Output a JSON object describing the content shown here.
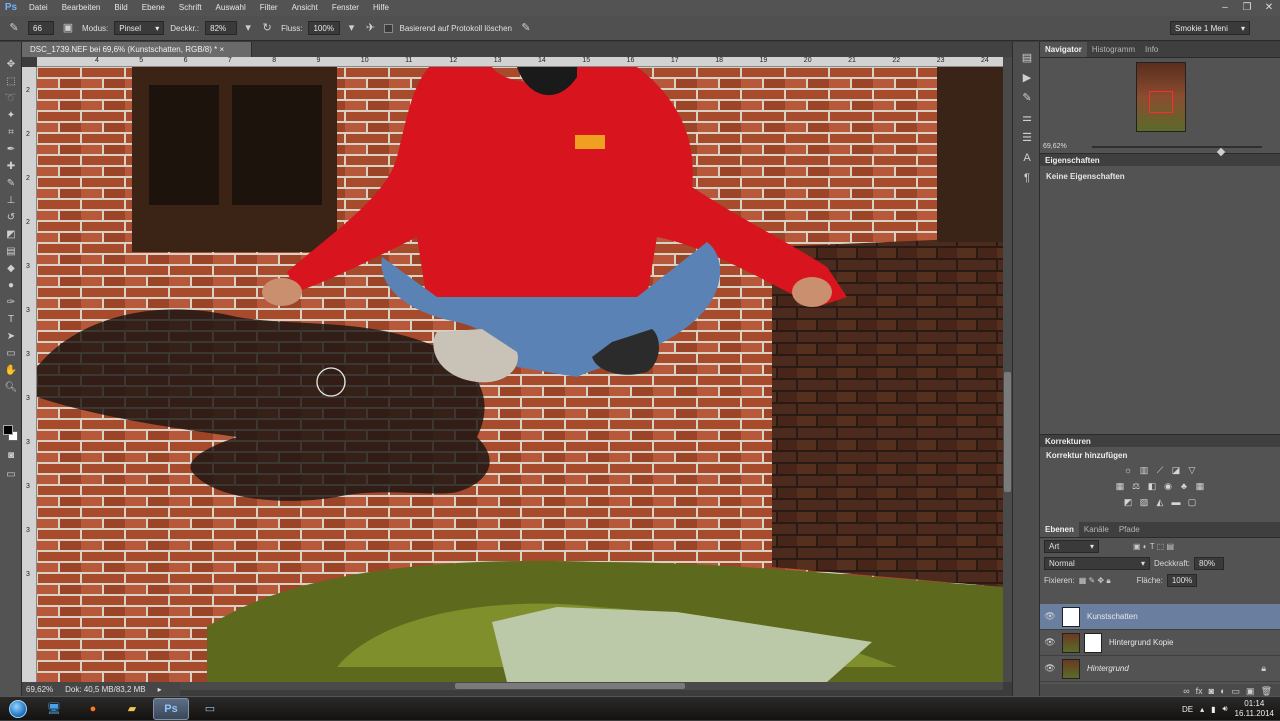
{
  "app": {
    "logo": "Ps"
  },
  "menu": [
    "Datei",
    "Bearbeiten",
    "Bild",
    "Ebene",
    "Schrift",
    "Auswahl",
    "Filter",
    "Ansicht",
    "Fenster",
    "Hilfe"
  ],
  "options": {
    "brush_size": "66",
    "modus_label": "Modus:",
    "modus_value": "Pinsel",
    "deckkr_label": "Deckkr.:",
    "deckkr_value": "82%",
    "fluss_label": "Fluss:",
    "fluss_value": "100%",
    "protokoll_label": "Basierend auf Protokoll löschen",
    "protokoll_checked": false,
    "workspace": "Smokie 1 Meni"
  },
  "document": {
    "tab_title": "DSC_1739.NEF bei 69,6% (Kunstschatten, RGB/8) *",
    "zoom": "69,62%",
    "doc_info": "Dok: 40,5 MB/83,2 MB"
  },
  "ruler_top": [
    "4",
    "5",
    "6",
    "7",
    "8",
    "9",
    "10",
    "11",
    "12",
    "13",
    "14",
    "15",
    "16",
    "17",
    "18",
    "19",
    "20",
    "21",
    "22",
    "23",
    "24"
  ],
  "ruler_left": [
    "2",
    "2",
    "2",
    "2",
    "3",
    "3",
    "3",
    "3",
    "3",
    "3",
    "3",
    "3"
  ],
  "navigator": {
    "tabs": [
      "Navigator",
      "Histogramm",
      "Info"
    ],
    "zoom": "69,62%"
  },
  "properties": {
    "title": "Eigenschaften",
    "empty_text": "Keine Eigenschaften"
  },
  "adjustments": {
    "title": "Korrekturen",
    "subtitle": "Korrektur hinzufügen"
  },
  "layers": {
    "tabs": [
      "Ebenen",
      "Kanäle",
      "Pfade"
    ],
    "filter": "Art",
    "blend_mode": "Normal",
    "opacity_label": "Deckkraft:",
    "opacity_value": "80%",
    "lock_label": "Fixieren:",
    "fill_label": "Fläche:",
    "fill_value": "100%",
    "items": [
      {
        "name": "Kunstschatten",
        "selected": true
      },
      {
        "name": "Hintergrund Kopie",
        "selected": false
      },
      {
        "name": "Hintergrund",
        "selected": false
      }
    ]
  },
  "taskbar": {
    "language": "DE",
    "time": "01:14",
    "date": "16.11.2014"
  },
  "colors": {
    "accent_selected_layer": "#6a7e9f",
    "nav_view_box": "#ff2a2a",
    "hoodie": "#d8141e"
  }
}
